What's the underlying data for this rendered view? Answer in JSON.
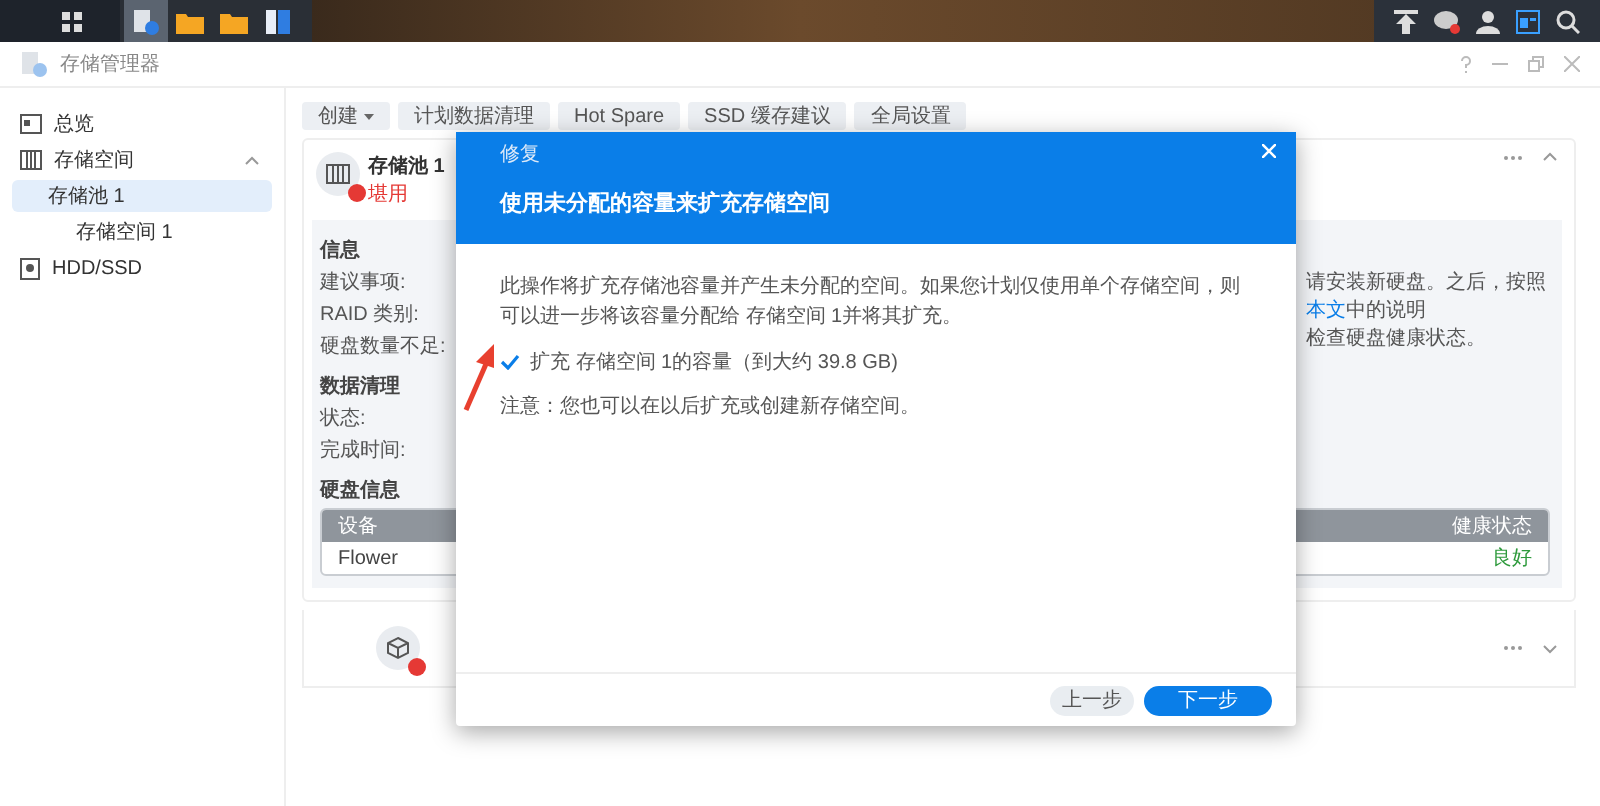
{
  "window": {
    "title": "存储管理器"
  },
  "sidebar": {
    "items": [
      {
        "label": "总览",
        "kind": "overview",
        "selected": false
      },
      {
        "label": "存储空间",
        "kind": "storage",
        "selected": false,
        "expanded": true,
        "children": [
          {
            "label": "存储池 1",
            "selected": true,
            "children": [
              {
                "label": "存储空间 1",
                "selected": false
              }
            ]
          }
        ]
      },
      {
        "label": "HDD/SSD",
        "kind": "disk",
        "selected": false
      }
    ]
  },
  "toolbar": [
    {
      "label": "创建",
      "kind": "dropdown"
    },
    {
      "label": "计划数据清理",
      "kind": "button"
    },
    {
      "label": "Hot Spare",
      "kind": "button"
    },
    {
      "label": "SSD 缓存建议",
      "kind": "button"
    },
    {
      "label": "全局设置",
      "kind": "button"
    }
  ],
  "pool": {
    "title": "存储池 1",
    "status": "堪用",
    "info_heading": "信息",
    "info_fields": [
      "建议事项:",
      "RAID 类别:",
      "硬盘数量不足:"
    ],
    "advice": {
      "before": "请安装新硬盘。之后，按照",
      "link": "本文",
      "after": "中的说明",
      "line2": "检查硬盘健康状态。"
    },
    "scrub_heading": "数据清理",
    "scrub_fields": [
      "状态:",
      "完成时间:"
    ],
    "disk_heading": "硬盘信息",
    "disk_columns": [
      "设备",
      "健康状态"
    ],
    "disk_rows": [
      [
        "Flower",
        "良好"
      ]
    ]
  },
  "modal": {
    "caption": "修复",
    "title": "使用未分配的容量来扩充存储空间",
    "description": "此操作将扩充存储池容量并产生未分配的空间。如果您计划仅使用单个存储空间，则可以进一步将该容量分配给 存储空间 1并将其扩充。",
    "checkbox": {
      "label": "扩充 存储空间 1的容量（到大约 39.8 GB)",
      "checked": true
    },
    "note": "注意：您也可以在以后扩充或创建新存储空间。",
    "buttons": [
      {
        "label": "上一步",
        "kind": "secondary"
      },
      {
        "label": "下一步",
        "kind": "primary"
      }
    ]
  }
}
